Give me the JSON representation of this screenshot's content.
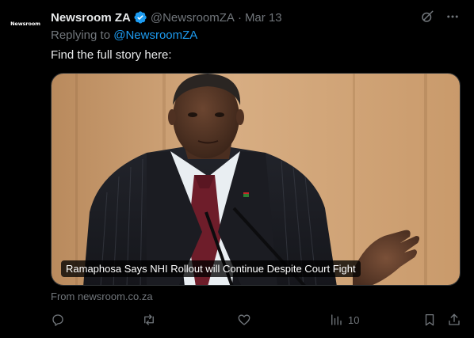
{
  "post": {
    "avatar_text": "Newsroom",
    "display_name": "Newsroom ZA",
    "verified_icon": "verified-badge-icon",
    "handle": "@NewsroomZA",
    "separator": "·",
    "date": "Mar 13",
    "reply_prefix": "Replying to",
    "reply_handle": "@NewsroomZA",
    "text": "Find the full story here:"
  },
  "card": {
    "caption": "Ramaphosa Says NHI Rollout will Continue Despite Court Fight",
    "source": "From newsroom.co.za"
  },
  "actions": {
    "reply_icon": "reply-icon",
    "repost_icon": "repost-icon",
    "like_icon": "like-icon",
    "views_icon": "views-icon",
    "views_count": "10",
    "bookmark_icon": "bookmark-icon",
    "share_icon": "share-icon"
  },
  "colors": {
    "background": "#000000",
    "primary_text": "#e7e9ea",
    "secondary_text": "#71767b",
    "accent": "#1d9bf0"
  }
}
